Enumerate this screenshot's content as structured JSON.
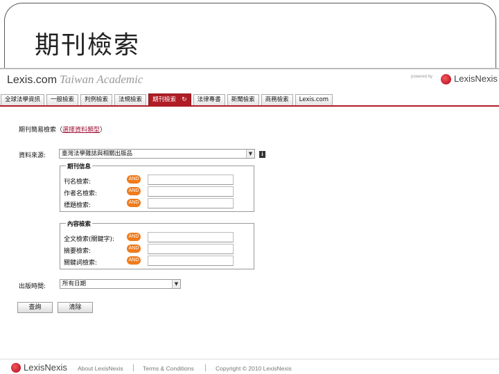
{
  "slide": {
    "title": "期刊檢索"
  },
  "brand": {
    "name": "Lexis.com",
    "subtitle": "Taiwan Academic",
    "powered_by": "powered by",
    "partner": "LexisNexis"
  },
  "tabs": [
    {
      "label": "全球法學資訊"
    },
    {
      "label": "一般檢索"
    },
    {
      "label": "判例檢索"
    },
    {
      "label": "法規檢索"
    },
    {
      "label": "期刊檢索",
      "active": true
    },
    {
      "label": "法律專書"
    },
    {
      "label": "新聞檢索"
    },
    {
      "label": "商務檢索"
    },
    {
      "label": "Lexis.com"
    }
  ],
  "search": {
    "heading": "期刊簡易檢索（",
    "heading_link": "選擇資料類型",
    "heading_end": "）",
    "source_label": "資料來源:",
    "source_value": "臺灣法學雜誌與相關出版品",
    "info_icon": "i",
    "group1": {
      "legend": "期刊信息",
      "rows": [
        {
          "label": "刊名檢索:",
          "op": "AND",
          "value": ""
        },
        {
          "label": "作者名檢索:",
          "op": "AND",
          "value": ""
        },
        {
          "label": "標題檢索:",
          "op": "AND",
          "value": ""
        }
      ]
    },
    "group2": {
      "legend": "內容檢索",
      "rows": [
        {
          "label": "全文檢索(關鍵字):",
          "op": "AND",
          "value": ""
        },
        {
          "label": "摘要檢索:",
          "op": "AND",
          "value": ""
        },
        {
          "label": "關鍵詞檢索:",
          "op": "AND",
          "value": ""
        }
      ]
    },
    "date_label": "出版時間:",
    "date_value": "所有日期",
    "submit_label": "查詢",
    "clear_label": "清除"
  },
  "footer": {
    "brand": "LexisNexis",
    "about": "About LexisNexis",
    "terms": "Terms & Conditions",
    "copyright": "Copyright © 2010 LexisNexis"
  },
  "colors": {
    "accent": "#b01c25",
    "and_badge": "#ef7b1d",
    "link": "#a0143a"
  }
}
